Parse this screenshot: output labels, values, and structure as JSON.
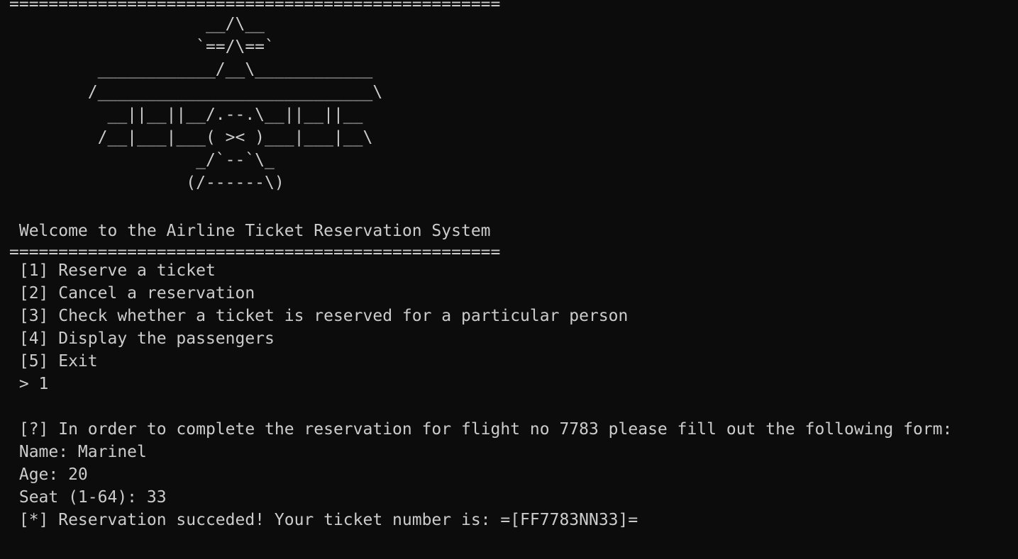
{
  "terminal": {
    "separator": "==================================================",
    "art": [
      "                    __/\\__",
      "                   `==/\\==`",
      "         ____________/__\\____________",
      "        /____________________________\\",
      "          __||__||__/.--.\\__||__||__",
      "         /__|___|___( >< )___|___|__\\",
      "                   _/`--`\\_",
      "                  (/------\\)"
    ],
    "welcome": " Welcome to the Airline Ticket Reservation System",
    "menu": [
      " [1] Reserve a ticket",
      " [2] Cancel a reservation",
      " [3] Check whether a ticket is reserved for a particular person",
      " [4] Display the passengers",
      " [5] Exit"
    ],
    "prompt": " > 1",
    "form_intro": " [?] In order to complete the reservation for flight no 7783 please fill out the following form:",
    "name_line": " Name: Marinel",
    "age_line": " Age: 20",
    "seat_line": " Seat (1-64): 33",
    "result_line": " [*] Reservation succeded! Your ticket number is: =[FF7783NN33]="
  }
}
